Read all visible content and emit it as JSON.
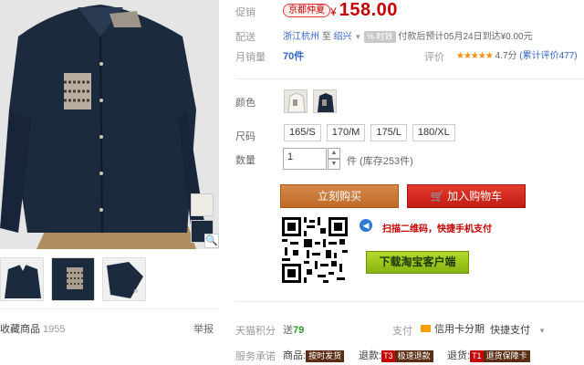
{
  "gallery": {
    "collect_label": "收藏商品",
    "collect_count": "1955",
    "report_label": "举报"
  },
  "promo": {
    "label": "促销",
    "tag": "京都仲夏",
    "currency": "¥",
    "price": "158.00"
  },
  "delivery": {
    "label": "配送",
    "from": "浙江杭州",
    "to_word": "至",
    "to": "绍兴",
    "hot_tag": "% 时效",
    "text": "付款后预计05月24日到达¥0.00元"
  },
  "sales": {
    "label": "月销量",
    "value": "70件",
    "review_label": "评价",
    "stars": "★★★★★",
    "score": "4.7分",
    "review_count": "(累计评价477)"
  },
  "options": {
    "color_label": "颜色",
    "size_label": "尺码",
    "sizes": [
      "165/S",
      "170/M",
      "175/L",
      "180/XL"
    ],
    "qty_label": "数量",
    "qty_value": "1",
    "stock": "件 (库存253件)"
  },
  "actions": {
    "buy": "立刻购买",
    "cart": "加入购物车",
    "scan_text": "扫描二维码，快捷手机支付",
    "download": "下载淘宝客户端"
  },
  "points": {
    "label": "天猫积分",
    "prefix": "送",
    "value": "79",
    "pay_label": "支付",
    "credit": "信用卡分期",
    "quick": "快捷支付"
  },
  "service": {
    "label": "服务承诺",
    "goods_label": "商品:",
    "goods_tag": "按时发货",
    "refund_label": "退款:",
    "refund_t": "T3",
    "refund_tag": "极速退款",
    "return_label": "退货:",
    "return_t": "T1",
    "return_tag": "退货保障卡"
  },
  "colors": {
    "price_red": "#c40000",
    "buy_orange": "#c06a27",
    "cart_red": "#c41b13",
    "download_green": "#86b30e",
    "shirt_navy": "#1c2a3e"
  }
}
